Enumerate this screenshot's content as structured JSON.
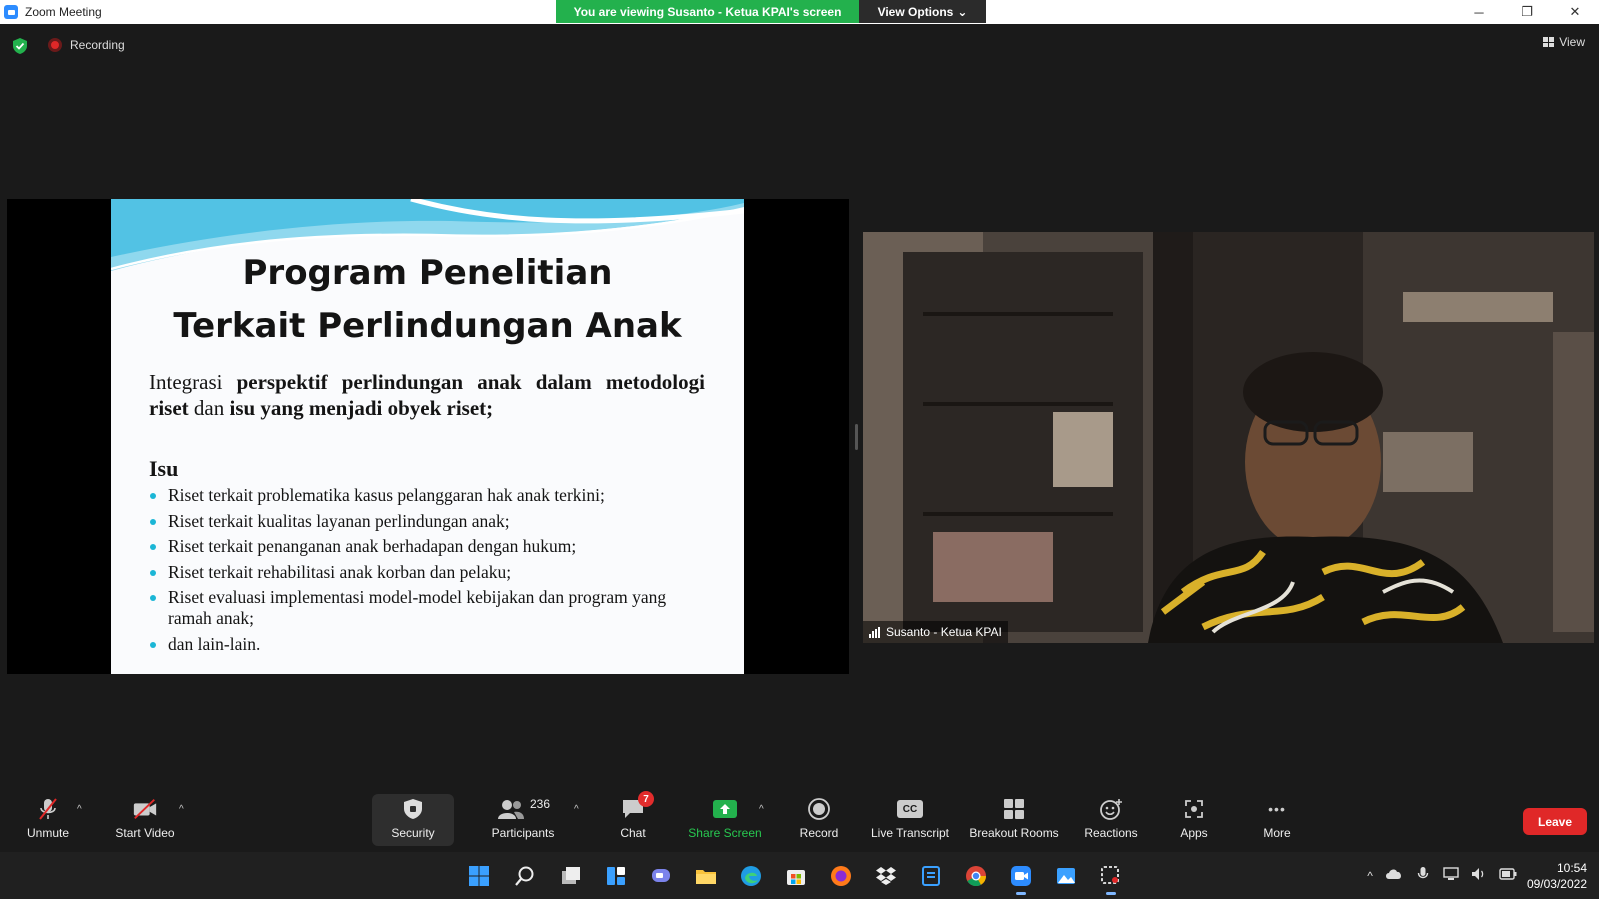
{
  "window": {
    "title": "Zoom Meeting",
    "minimize_glyph": "─",
    "restore_glyph": "❐",
    "close_glyph": "✕"
  },
  "share_banner": {
    "text": "You are viewing Susanto - Ketua KPAI's screen",
    "view_options": "View Options",
    "chevron_glyph": "⌄"
  },
  "status": {
    "recording_label": "Recording",
    "view_label": "View"
  },
  "slide": {
    "title_line1": "Program Penelitian",
    "title_line2": "Terkait Perlindungan Anak",
    "intro_part1": "Integrasi ",
    "intro_bold1": "perspektif perlindungan anak dalam metodologi riset",
    "intro_part2": " dan ",
    "intro_bold2": "isu yang menjadi obyek riset;",
    "isu_heading": "Isu",
    "bullets": [
      "Riset terkait problematika kasus pelanggaran hak anak terkini;",
      "Riset terkait kualitas layanan perlindungan anak;",
      "Riset terkait penanganan anak berhadapan dengan hukum;",
      "Riset terkait rehabilitasi anak korban dan pelaku;",
      "Riset evaluasi implementasi model-model kebijakan dan program yang ramah anak;",
      "dan lain-lain."
    ],
    "accent_color": "#1bb6d6"
  },
  "video": {
    "participant_name": "Susanto - Ketua KPAI"
  },
  "toolbar": {
    "unmute": "Unmute",
    "start_video": "Start Video",
    "security": "Security",
    "participants": "Participants",
    "participants_count": "236",
    "chat": "Chat",
    "chat_badge": "7",
    "share_screen": "Share Screen",
    "record": "Record",
    "live_transcript": "Live Transcript",
    "cc_glyph": "CC",
    "breakout_rooms": "Breakout Rooms",
    "reactions": "Reactions",
    "apps": "Apps",
    "more": "More",
    "more_glyph": "•••",
    "leave": "Leave",
    "caret_glyph": "^",
    "share_color": "#28c850",
    "leave_color": "#e02828"
  },
  "taskbar": {
    "time": "10:54",
    "date": "09/03/2022",
    "tray_caret": "^"
  }
}
